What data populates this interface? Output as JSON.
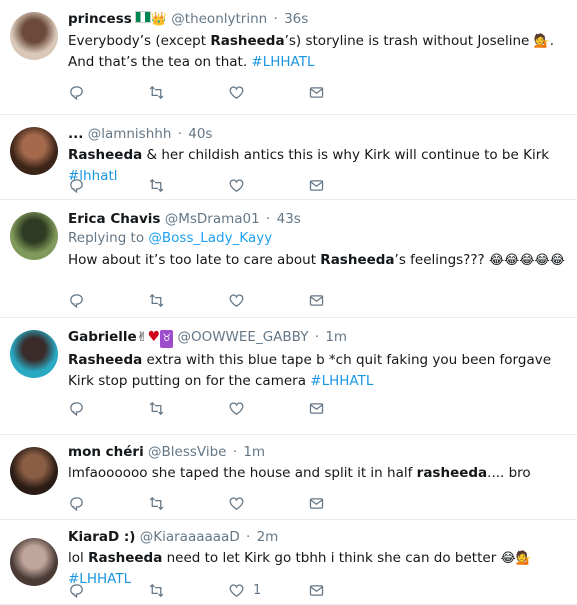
{
  "tweets": [
    {
      "name": "princess",
      "name_emojis": [
        "flag-ng",
        "crown"
      ],
      "handle": "@theonlytrinn",
      "time": "36s",
      "text_parts": [
        {
          "t": "Everybody’s (except ",
          "s": "plain"
        },
        {
          "t": "Rasheeda",
          "s": "bold"
        },
        {
          "t": "’s) storyline is trash without Joseline ",
          "s": "plain"
        },
        {
          "t": "💁",
          "s": "emoji"
        },
        {
          "t": ". And that’s the tea on that. ",
          "s": "plain"
        },
        {
          "t": "#LHHATL",
          "s": "hashtag"
        }
      ],
      "avatar_colors": [
        "#d9c8b8",
        "#6b4a3a"
      ],
      "likes": ""
    },
    {
      "name": "...",
      "handle": "@lamnishhh",
      "time": "40s",
      "text_parts": [
        {
          "t": "Rasheeda",
          "s": "bold"
        },
        {
          "t": " & her childish antics this is why Kirk will continue to be Kirk ",
          "s": "plain"
        },
        {
          "t": "#lhhatl",
          "s": "hashtag"
        }
      ],
      "avatar_colors": [
        "#3b2418",
        "#a56a4c"
      ],
      "likes": ""
    },
    {
      "name": "Erica Chavis",
      "handle": "@MsDrama01",
      "time": "43s",
      "reply_prefix": "Replying to ",
      "reply_to": "@Boss_Lady_Kayy",
      "text_parts": [
        {
          "t": "How about it’s too late to care about ",
          "s": "plain"
        },
        {
          "t": "Rasheeda",
          "s": "bold"
        },
        {
          "t": "’s feelings??? ",
          "s": "plain"
        },
        {
          "t": "😂😂😂😂😂",
          "s": "emoji"
        }
      ],
      "avatar_colors": [
        "#7f9a5a",
        "#2f3a22"
      ],
      "likes": ""
    },
    {
      "name": "Gabrielle",
      "name_emojis": [
        "hand",
        "heart",
        "taurus"
      ],
      "handle": "@OOWWEE_GABBY",
      "time": "1m",
      "text_parts": [
        {
          "t": "Rasheeda",
          "s": "bold"
        },
        {
          "t": " extra with this blue tape b *ch quit faking you been forgave Kirk stop putting on for the camera ",
          "s": "plain"
        },
        {
          "t": "#LHHATL",
          "s": "hashtag"
        }
      ],
      "avatar_colors": [
        "#29a9c2",
        "#3a2a2a"
      ],
      "likes": ""
    },
    {
      "name": "mon chéri",
      "handle": "@BlessVibe",
      "time": "1m",
      "text_parts": [
        {
          "t": "lmfaoooooo she taped the house and split it in half ",
          "s": "plain"
        },
        {
          "t": "rasheeda",
          "s": "bold"
        },
        {
          "t": ".... bro",
          "s": "plain"
        }
      ],
      "avatar_colors": [
        "#2b1c16",
        "#8a5e44"
      ],
      "likes": ""
    },
    {
      "name": "KiaraD :)",
      "handle": "@KiaraaaaaaD",
      "time": "2m",
      "text_parts": [
        {
          "t": "lol ",
          "s": "plain"
        },
        {
          "t": "Rasheeda",
          "s": "bold"
        },
        {
          "t": " need to let Kirk go tbhh i think she can do better ",
          "s": "plain"
        },
        {
          "t": "😂💁",
          "s": "emoji"
        },
        {
          "t": " ",
          "s": "plain"
        },
        {
          "t": "#LHHATL",
          "s": "hashtag"
        }
      ],
      "avatar_colors": [
        "#4a3a36",
        "#bfa59a"
      ],
      "likes": "1"
    }
  ],
  "colors": {
    "icon": "#657786",
    "link": "#1da1f2",
    "hashtag": "#1b95e0",
    "divider": "#e6ecf0"
  }
}
